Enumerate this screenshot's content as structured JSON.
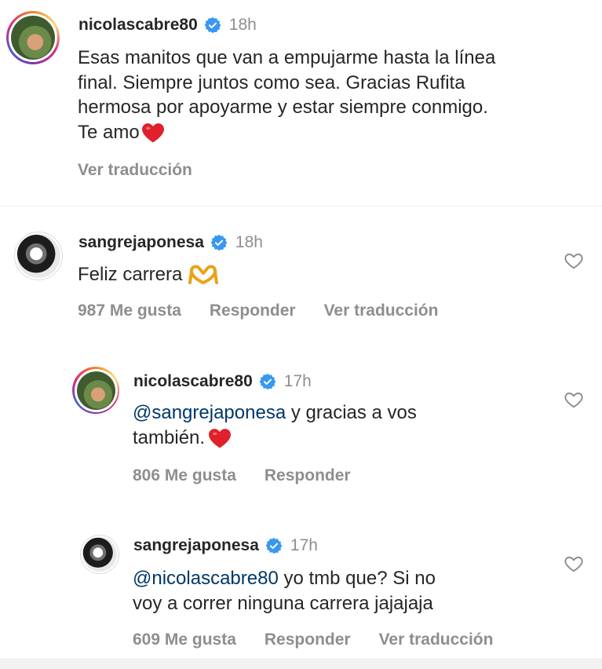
{
  "comments": [
    {
      "username": "nicolascabre80",
      "time": "18h",
      "text_lines": [
        "Esas manitos que van a empujarme hasta la línea",
        "final.  Siempre juntos como sea.  Gracias Rufita",
        "hermosa por apoyarme y estar siempre conmigo.",
        "Te amo"
      ],
      "translate": "Ver traducción"
    },
    {
      "username": "sangrejaponesa",
      "time": "18h",
      "text": "Feliz carrera",
      "likes": "987 Me gusta",
      "reply": "Responder",
      "translate": "Ver traducción"
    },
    {
      "username": "nicolascabre80",
      "time": "17h",
      "mention": "@sangrejaponesa",
      "text_line1": " y gracias a vos",
      "text_line2": "también. ",
      "likes": "806 Me gusta",
      "reply": "Responder"
    },
    {
      "username": "sangrejaponesa",
      "time": "17h",
      "mention": "@nicolascabre80",
      "text_line1": " yo tmb que? Si no",
      "text_line2": "voy a correr ninguna carrera jajajaja",
      "likes": "609 Me gusta",
      "reply": "Responder",
      "translate": "Ver traducción"
    }
  ],
  "icons": {
    "verified": "verified-badge-icon",
    "heart": "heart-outline-icon",
    "red_heart": "red-heart-emoji",
    "hands": "heart-hands-emoji"
  },
  "colors": {
    "verified_blue": "#3897f0",
    "mention_blue": "#00376b",
    "secondary_gray": "#8e8e8e",
    "heart_red": "#e0202a"
  }
}
